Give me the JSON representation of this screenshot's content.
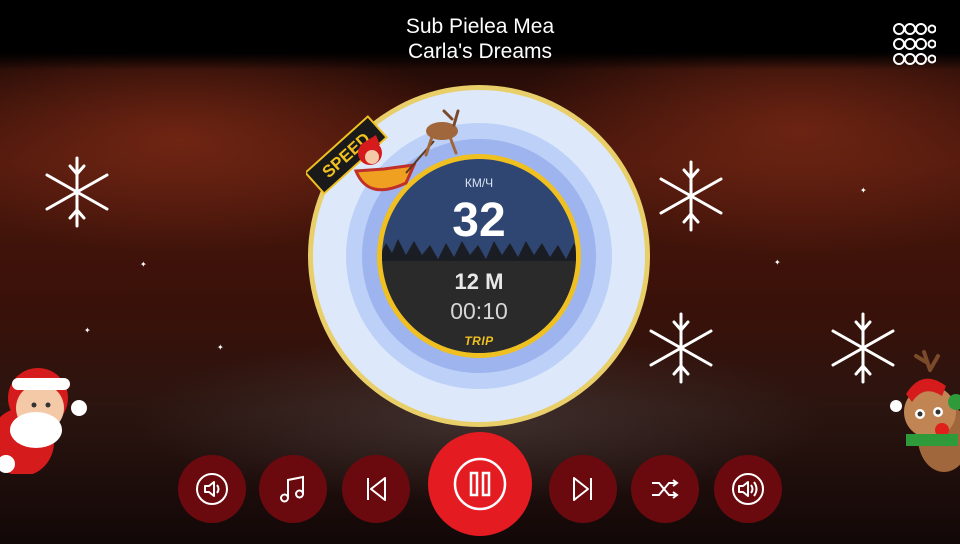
{
  "track": {
    "title": "Sub Pielea Mea",
    "artist": "Carla's Dreams"
  },
  "gauge": {
    "badge": "SPEED",
    "unit": "КМ/Ч",
    "speed": "32",
    "distance": "12 M",
    "time": "00:10",
    "mode": "TRIP"
  },
  "controls": [
    {
      "name": "volume-down-button",
      "icon": "speaker-icon"
    },
    {
      "name": "music-library-button",
      "icon": "music-note-icon"
    },
    {
      "name": "previous-track-button",
      "icon": "skip-back-icon"
    },
    {
      "name": "pause-button",
      "icon": "pause-icon"
    },
    {
      "name": "next-track-button",
      "icon": "skip-forward-icon"
    },
    {
      "name": "shuffle-button",
      "icon": "shuffle-icon"
    },
    {
      "name": "volume-up-button",
      "icon": "speaker-icon"
    }
  ],
  "colors": {
    "accent_red": "#e41c22",
    "dark_red": "#6b0a0e",
    "gauge_gold": "#f0c020",
    "gauge_blue": "#9db4ee",
    "night_sky": "#2f4672"
  }
}
